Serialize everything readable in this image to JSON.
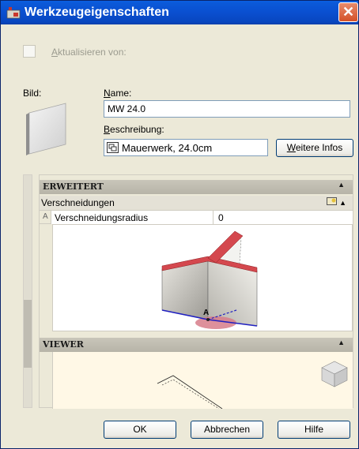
{
  "window": {
    "title": "Werkzeugeigenschaften",
    "close_glyph": "✕"
  },
  "update": {
    "prefix": "A",
    "rest": "ktualisieren von:"
  },
  "bild": {
    "label": "Bild:"
  },
  "name": {
    "label_first": "N",
    "label_rest": "ame:",
    "value": "MW 24.0"
  },
  "description": {
    "label_first": "B",
    "label_rest": "eschreibung:",
    "value": "Mauerwerk, 24.0cm",
    "more_first": "W",
    "more_rest": "eitere Infos"
  },
  "palette": {
    "sections": [
      {
        "title": "ERWEITERT"
      },
      {
        "title": "VIEWER"
      }
    ],
    "category": "Verschneidungen",
    "property": {
      "prefix": "A",
      "name": "Verschneidungsradius",
      "value": "0"
    },
    "diagram_label": "A"
  },
  "buttons": {
    "ok": "OK",
    "cancel": "Abbrechen",
    "help": "Hilfe"
  },
  "icons": [
    "app-icon",
    "close-icon",
    "checkbox",
    "wall-preview-icon",
    "description-icon",
    "collapse-arrow-icon",
    "help-icon",
    "viewcube-icon"
  ],
  "colors": {
    "titlebar": "#0a4fd0",
    "close": "#d45128",
    "wall_edge": "#c0363c",
    "wall_line": "#2020c0"
  }
}
